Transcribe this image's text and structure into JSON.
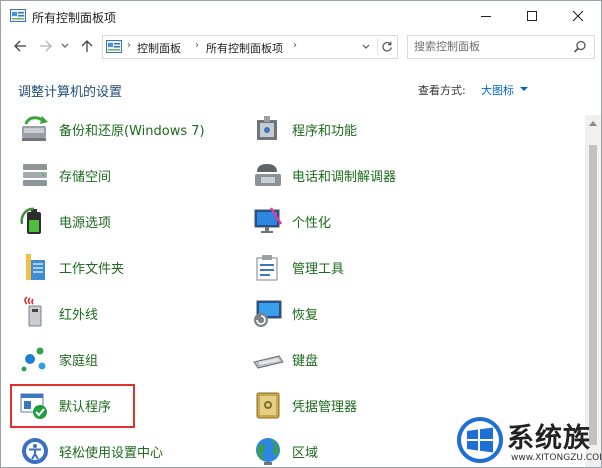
{
  "window": {
    "title": "所有控制面板项"
  },
  "navbar": {
    "breadcrumbs": [
      "控制面板",
      "所有控制面板项"
    ],
    "search_placeholder": "搜索控制面板"
  },
  "header": {
    "heading": "调整计算机的设置",
    "view_by_label": "查看方式:",
    "view_by_value": "大图标"
  },
  "items": [
    {
      "label": "备份和还原(Windows 7)",
      "icon": "backup-restore-icon"
    },
    {
      "label": "程序和功能",
      "icon": "programs-features-icon"
    },
    {
      "label": "存储空间",
      "icon": "storage-spaces-icon"
    },
    {
      "label": "电话和调制解调器",
      "icon": "phone-modem-icon"
    },
    {
      "label": "电源选项",
      "icon": "power-options-icon"
    },
    {
      "label": "个性化",
      "icon": "personalization-icon"
    },
    {
      "label": "工作文件夹",
      "icon": "work-folders-icon"
    },
    {
      "label": "管理工具",
      "icon": "admin-tools-icon"
    },
    {
      "label": "红外线",
      "icon": "infrared-icon"
    },
    {
      "label": "恢复",
      "icon": "recovery-icon"
    },
    {
      "label": "家庭组",
      "icon": "homegroup-icon"
    },
    {
      "label": "键盘",
      "icon": "keyboard-icon"
    },
    {
      "label": "默认程序",
      "icon": "default-programs-icon",
      "highlighted": true
    },
    {
      "label": "凭据管理器",
      "icon": "credential-manager-icon"
    },
    {
      "label": "轻松使用设置中心",
      "icon": "ease-of-access-icon"
    },
    {
      "label": "区域",
      "icon": "region-icon"
    }
  ],
  "watermark": {
    "name": "系统族",
    "url": "www.XITONGZU.COM"
  },
  "colors": {
    "heading": "#1e4e79",
    "item_label": "#1d6a1d",
    "link": "#0066cc",
    "highlight": "#e0312c"
  }
}
